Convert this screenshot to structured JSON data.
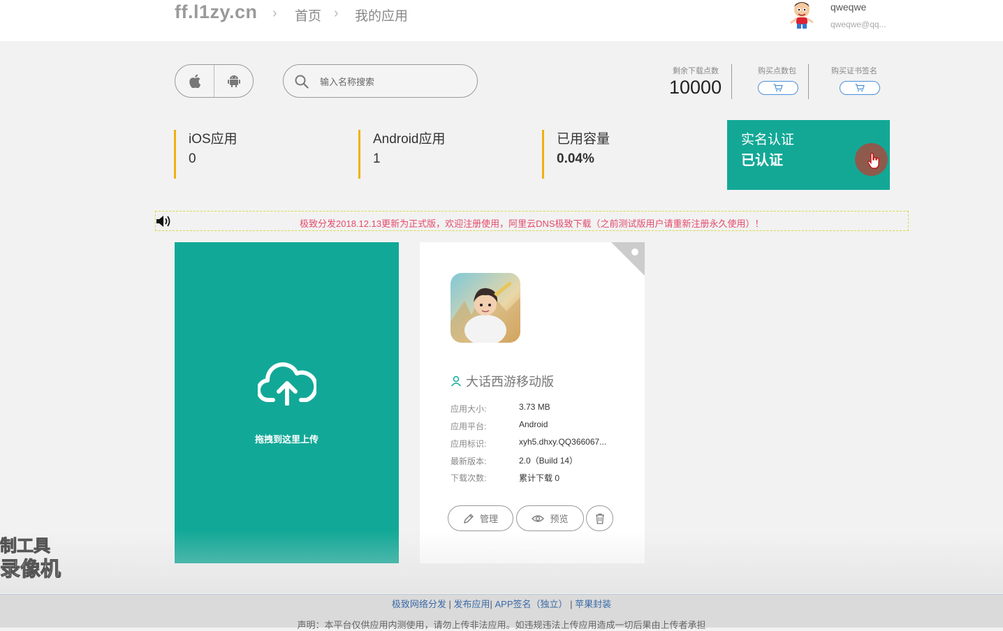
{
  "header": {
    "logo": "ff.l1zy.cn",
    "breadcrumb": [
      "首页",
      "我的应用"
    ],
    "user": {
      "name": "qweqwe",
      "email": "qweqwe@qq..."
    }
  },
  "toolbar": {
    "search_placeholder": "输入名称搜索",
    "remaining_label": "剩余下载点数",
    "remaining_value": "10000",
    "buy_points_label": "购买点数包",
    "buy_cert_label": "购买证书签名"
  },
  "stats": {
    "ios_label": "iOS应用",
    "ios_value": "0",
    "android_label": "Android应用",
    "android_value": "1",
    "storage_label": "已用容量",
    "storage_value": "0.04%",
    "verify_label": "实名认证",
    "verify_value": "已认证"
  },
  "notice": "极致分发2018.12.13更新为正式版，欢迎注册使用，阿里云DNS极致下载（之前测试版用户请重新注册永久使用）！",
  "upload": {
    "label": "拖拽到这里上传"
  },
  "app_card": {
    "name": "大话西游移动版",
    "fields": [
      {
        "key": "应用大小:",
        "value": "3.73 MB"
      },
      {
        "key": "应用平台:",
        "value": "Android"
      },
      {
        "key": "应用标识:",
        "value": "xyh5.dhxy.QQ366067..."
      },
      {
        "key": "最新版本:",
        "value": "2.0（Build 14）"
      },
      {
        "key": "下载次数:",
        "value": "累计下载 0"
      }
    ],
    "manage_label": "管理",
    "preview_label": "预览"
  },
  "watermark": {
    "line1": "制工具",
    "line2": "录像机"
  },
  "footer": {
    "links": [
      "极致网络分发",
      "发布应用",
      "APP签名（独立）",
      "苹果封装"
    ],
    "note": "声明：本平台仅供应用内测使用，请勿上传非法应用。如违规违法上传应用造成一切后果由上传者承担"
  },
  "colors": {
    "accent": "#13a896",
    "kpi_bar": "#f0b10e",
    "notice": "#e44a6c",
    "link": "#3a6aa6"
  }
}
